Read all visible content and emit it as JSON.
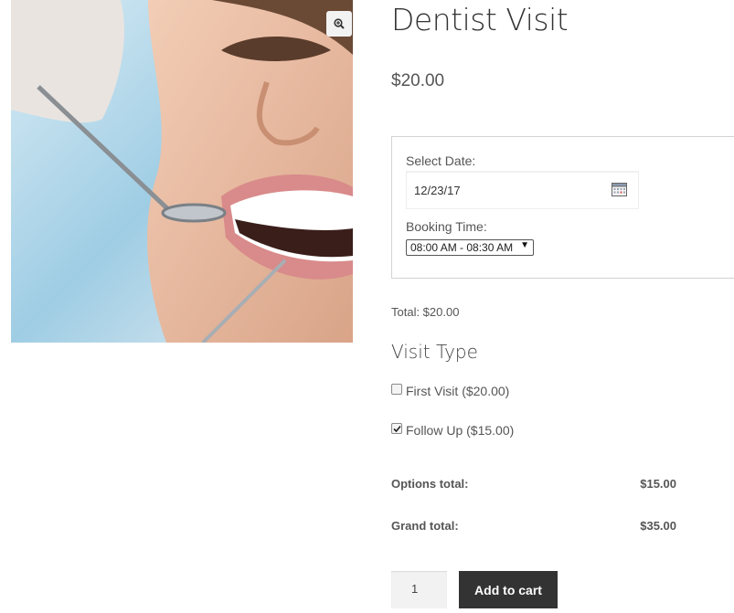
{
  "product": {
    "title": "Dentist Visit",
    "price": "$20.00",
    "image_alt": "Woman at dental checkup with dental mirror and probe",
    "zoom_icon": "zoom-in-icon"
  },
  "booking": {
    "date_label": "Select Date:",
    "date_value": "12/23/17",
    "calendar_icon": "calendar-icon",
    "time_label": "Booking Time:",
    "time_value": "08:00 AM - 08:30 AM"
  },
  "total_line": "Total: $20.00",
  "visit_type": {
    "title": "Visit Type",
    "options": [
      {
        "label": "First Visit ($20.00)",
        "checked": false
      },
      {
        "label": "Follow Up ($15.00)",
        "checked": true
      }
    ]
  },
  "totals": {
    "options_label": "Options total:",
    "options_value": "$15.00",
    "grand_label": "Grand total:",
    "grand_value": "$35.00"
  },
  "cart": {
    "quantity": "1",
    "button_label": "Add to cart"
  },
  "colors": {
    "button_bg": "#333333",
    "text": "#555555",
    "box_border": "#d3d3d3"
  }
}
